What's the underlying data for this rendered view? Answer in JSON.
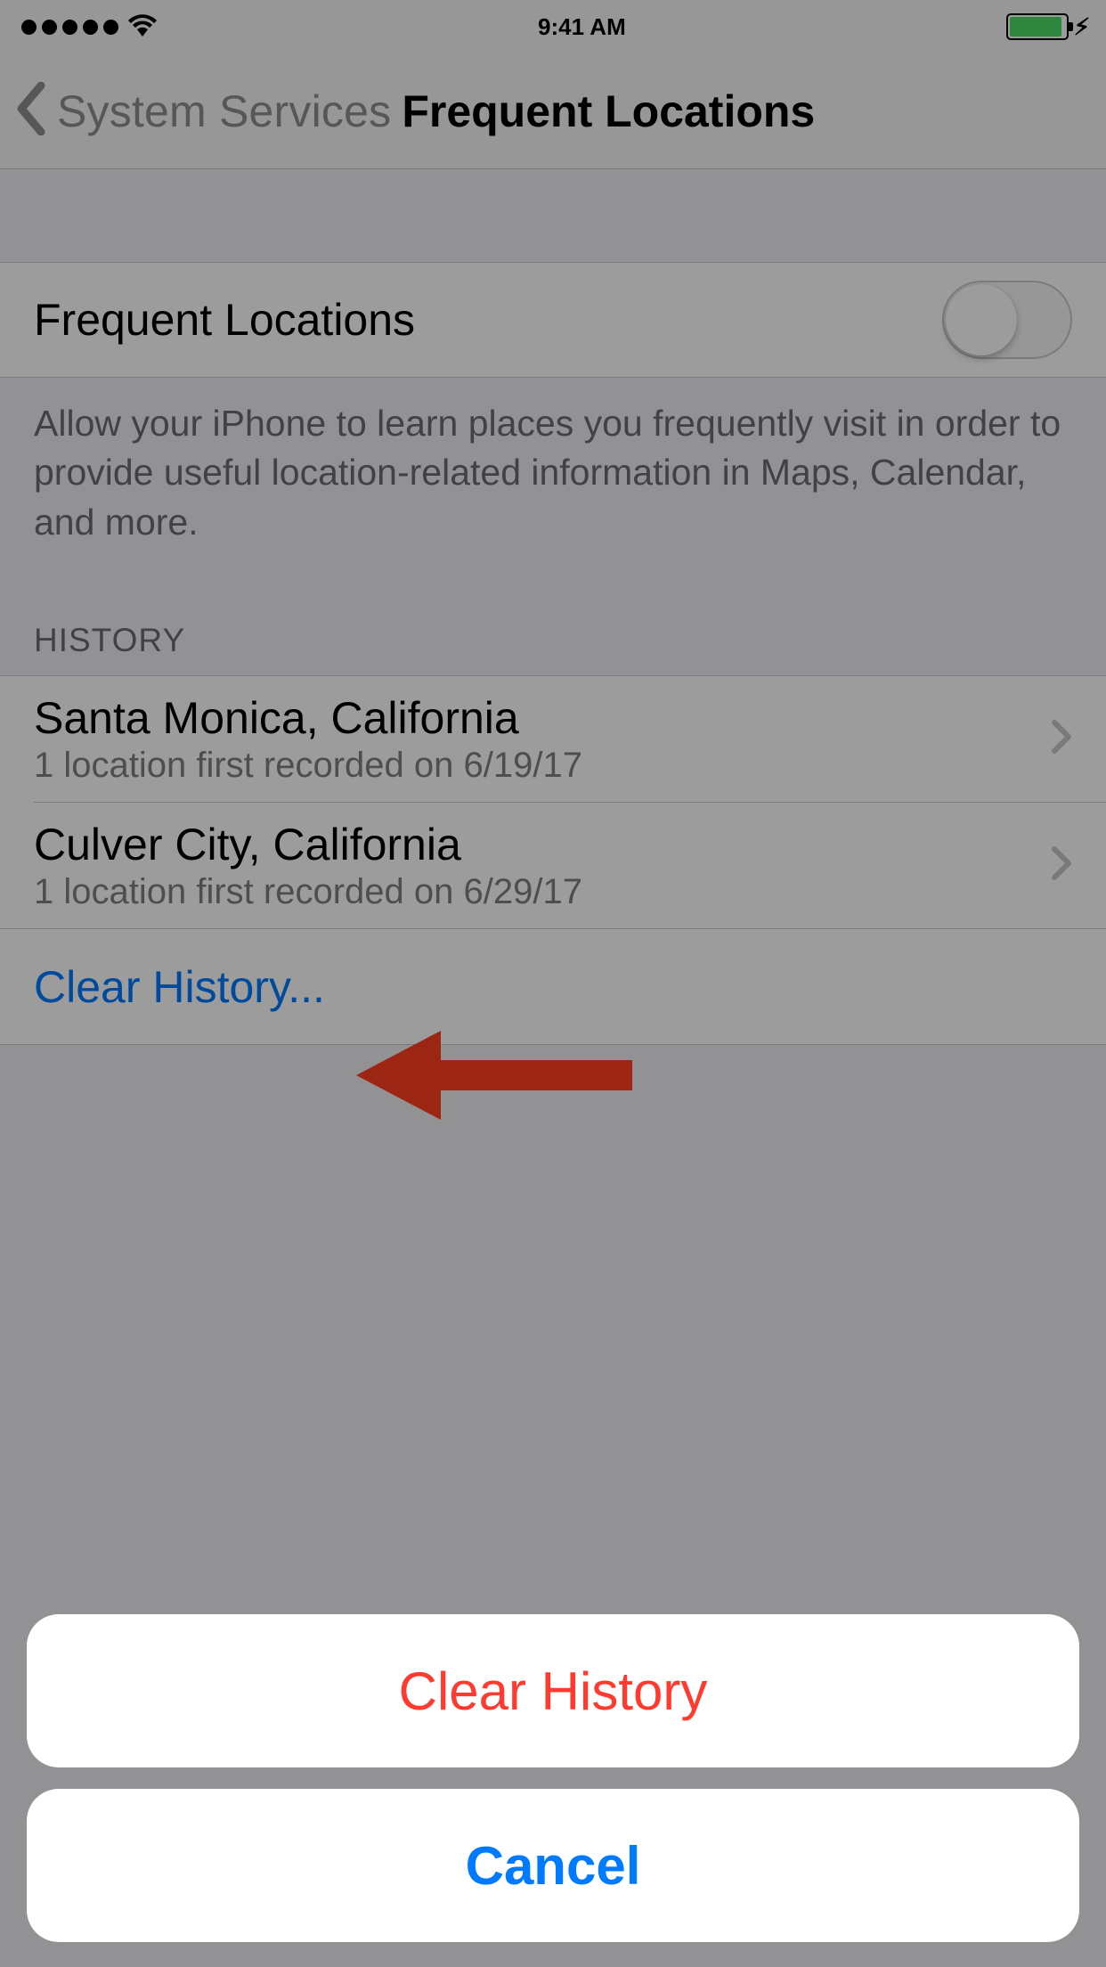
{
  "statusBar": {
    "time": "9:41 AM"
  },
  "nav": {
    "backLabel": "System Services",
    "title": "Frequent Locations"
  },
  "toggleRow": {
    "label": "Frequent Locations"
  },
  "description": "Allow your iPhone to learn places you frequently visit in order to provide useful location-related information in Maps, Calendar, and more.",
  "historyHeader": "HISTORY",
  "history": [
    {
      "title": "Santa Monica, California",
      "subtitle": "1 location first recorded on 6/19/17"
    },
    {
      "title": "Culver City, California",
      "subtitle": "1 location first recorded on 6/29/17"
    }
  ],
  "clearRow": "Clear History...",
  "sheet": {
    "destructive": "Clear History",
    "cancel": "Cancel"
  },
  "colors": {
    "blue": "#007aff",
    "red": "#ff3b30",
    "green": "#4cd964",
    "arrow": "#ff3d1f"
  }
}
